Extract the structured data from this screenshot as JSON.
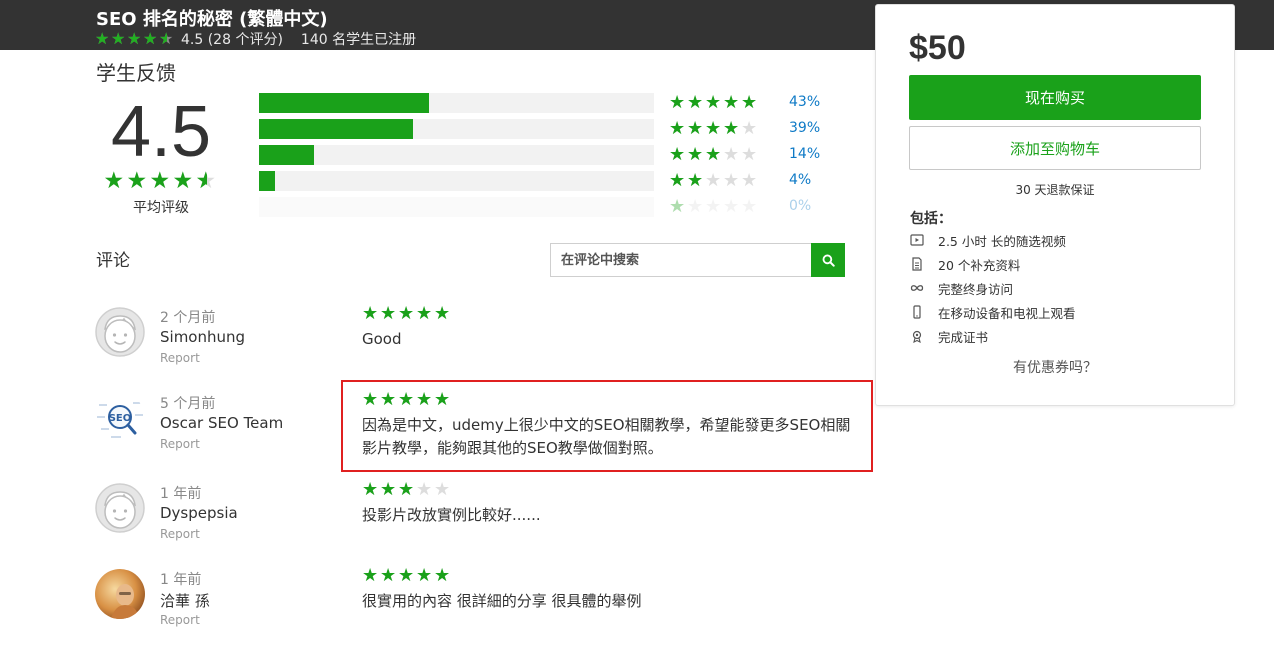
{
  "header": {
    "title": "SEO 排名的秘密 (繁體中文)",
    "rating_value": 4.5,
    "rating_text": "4.5 (28 个评分)",
    "enrolled": "140 名学生已注册"
  },
  "feedback": {
    "title": "学生反馈",
    "average": "4.5",
    "average_value": 4.5,
    "average_label": "平均评级",
    "distribution": [
      {
        "stars": 5,
        "percent": 43,
        "label": "43%"
      },
      {
        "stars": 4,
        "percent": 39,
        "label": "39%"
      },
      {
        "stars": 3,
        "percent": 14,
        "label": "14%"
      },
      {
        "stars": 2,
        "percent": 4,
        "label": "4%"
      },
      {
        "stars": 1,
        "percent": 0,
        "label": "0%"
      }
    ]
  },
  "reviews": {
    "title": "评论",
    "search_placeholder": "在评论中搜索",
    "items": [
      {
        "time": "2 个月前",
        "name": "Simonhung",
        "report": "Report",
        "rating": 5,
        "text": "Good",
        "avatar": "default-face"
      },
      {
        "time": "5 个月前",
        "name": "Oscar SEO Team",
        "report": "Report",
        "rating": 5,
        "text": "因為是中文，udemy上很少中文的SEO相關教學，希望能發更多SEO相關影片教學，能夠跟其他的SEO教學做個對照。",
        "avatar": "seo-logo",
        "avatar_text": "SEO"
      },
      {
        "time": "1 年前",
        "name": "Dyspepsia",
        "report": "Report",
        "rating": 3,
        "text": "投影片改放實例比較好......",
        "avatar": "default-face"
      },
      {
        "time": "1 年前",
        "name": "洽華 孫",
        "report": "Report",
        "rating": 5,
        "text": "很實用的內容 很詳細的分享 很具體的舉例",
        "avatar": "photo"
      }
    ]
  },
  "sidebar": {
    "price": "$50",
    "buy_label": "现在购买",
    "cart_label": "添加至购物车",
    "guarantee": "30 天退款保证",
    "includes_title": "包括：",
    "includes": [
      {
        "icon": "video-icon",
        "text": "2.5 小时 长的随选视频"
      },
      {
        "icon": "document-icon",
        "text": "20 个补充资料"
      },
      {
        "icon": "infinity-icon",
        "text": "完整终身访问"
      },
      {
        "icon": "mobile-icon",
        "text": "在移动设备和电视上观看"
      },
      {
        "icon": "certificate-icon",
        "text": "完成证书"
      }
    ],
    "coupon": "有优惠券吗？"
  },
  "colors": {
    "accent": "#1aa11a",
    "topbar": "#333333",
    "link": "#0f7ac6",
    "highlight": "#e02020"
  }
}
